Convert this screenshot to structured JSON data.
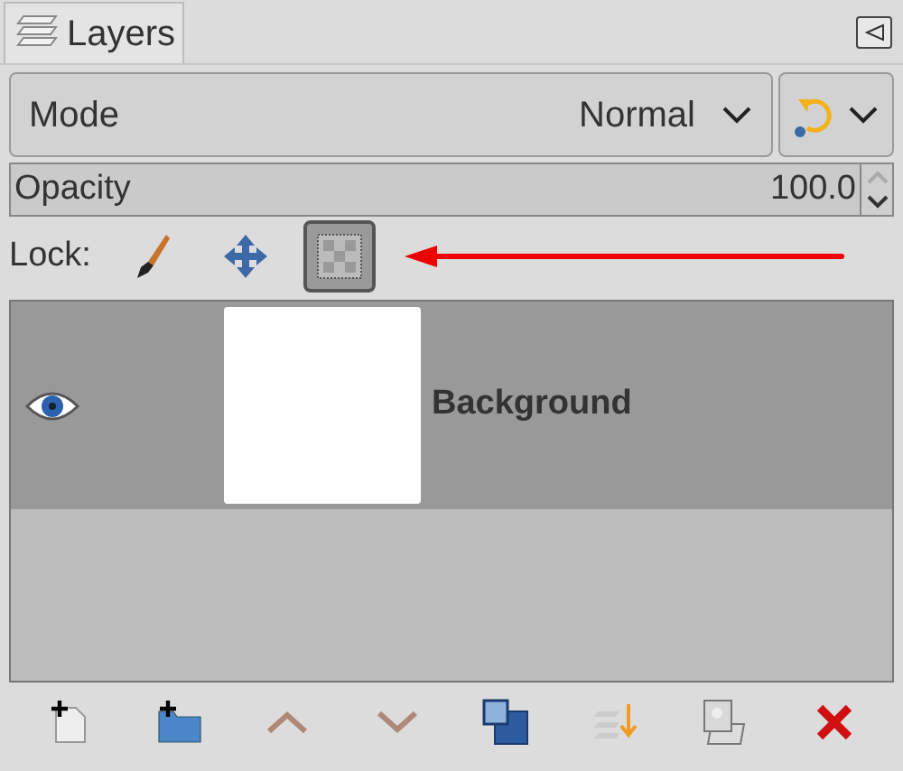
{
  "tab": {
    "label": "Layers",
    "selected": true
  },
  "mode": {
    "label": "Mode",
    "value": "Normal"
  },
  "opacity": {
    "label": "Opacity",
    "value": "100.0",
    "level": 1
  },
  "lock": {
    "label": "Lock:",
    "items": [
      {
        "kind": "pixels",
        "on": false
      },
      {
        "kind": "position",
        "on": false
      },
      {
        "kind": "alpha",
        "on": true
      }
    ]
  },
  "layers": [
    {
      "name": "Background",
      "visible": true,
      "selected": true
    }
  ],
  "buttons": [
    {
      "kind": "new-layer"
    },
    {
      "kind": "new-group"
    },
    {
      "kind": "raise"
    },
    {
      "kind": "lower"
    },
    {
      "kind": "duplicate"
    },
    {
      "kind": "anchor"
    },
    {
      "kind": "mask"
    },
    {
      "kind": "delete"
    }
  ]
}
